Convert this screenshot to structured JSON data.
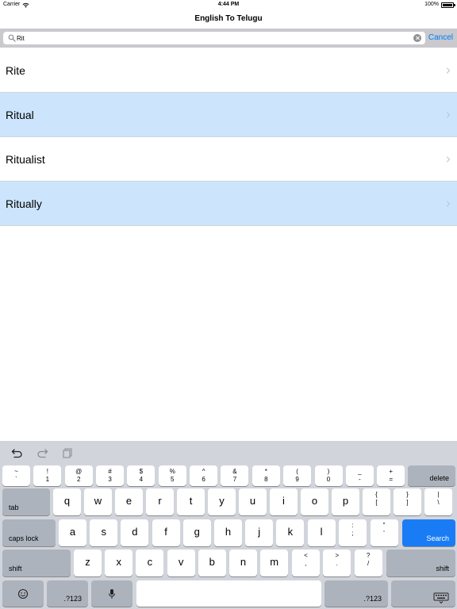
{
  "status_bar": {
    "carrier": "Carrier",
    "time": "4:44 PM",
    "battery": "100%"
  },
  "nav": {
    "title": "English To Telugu"
  },
  "search": {
    "value": "Rit",
    "placeholder": "",
    "cancel_label": "Cancel"
  },
  "results": [
    {
      "label": "Rite",
      "highlighted": false
    },
    {
      "label": "Ritual",
      "highlighted": true
    },
    {
      "label": "Ritualist",
      "highlighted": false
    },
    {
      "label": "Ritually",
      "highlighted": true
    }
  ],
  "keyboard": {
    "number_row": [
      {
        "top": "~",
        "bottom": "`"
      },
      {
        "top": "!",
        "bottom": "1"
      },
      {
        "top": "@",
        "bottom": "2"
      },
      {
        "top": "#",
        "bottom": "3"
      },
      {
        "top": "$",
        "bottom": "4"
      },
      {
        "top": "%",
        "bottom": "5"
      },
      {
        "top": "^",
        "bottom": "6"
      },
      {
        "top": "&",
        "bottom": "7"
      },
      {
        "top": "*",
        "bottom": "8"
      },
      {
        "top": "(",
        "bottom": "9"
      },
      {
        "top": ")",
        "bottom": "0"
      },
      {
        "top": "_",
        "bottom": "-"
      },
      {
        "top": "+",
        "bottom": "="
      }
    ],
    "delete_label": "delete",
    "tab_label": "tab",
    "row_q": [
      "q",
      "w",
      "e",
      "r",
      "t",
      "y",
      "u",
      "i",
      "o",
      "p"
    ],
    "row_q_symbols": [
      {
        "top": "{",
        "bottom": "["
      },
      {
        "top": "}",
        "bottom": "]"
      },
      {
        "top": "|",
        "bottom": "\\"
      }
    ],
    "caps_lock_label": "caps lock",
    "row_a": [
      "a",
      "s",
      "d",
      "f",
      "g",
      "h",
      "j",
      "k",
      "l"
    ],
    "row_a_symbols": [
      {
        "top": ":",
        "bottom": ";"
      },
      {
        "top": "\"",
        "bottom": "'"
      }
    ],
    "search_label": "Search",
    "shift_label": "shift",
    "row_z": [
      "z",
      "x",
      "c",
      "v",
      "b",
      "n",
      "m"
    ],
    "row_z_symbols": [
      {
        "top": "<",
        "bottom": ","
      },
      {
        "top": ">",
        "bottom": "."
      },
      {
        "top": "?",
        "bottom": "/"
      }
    ],
    "numbers_label": ".?123"
  }
}
